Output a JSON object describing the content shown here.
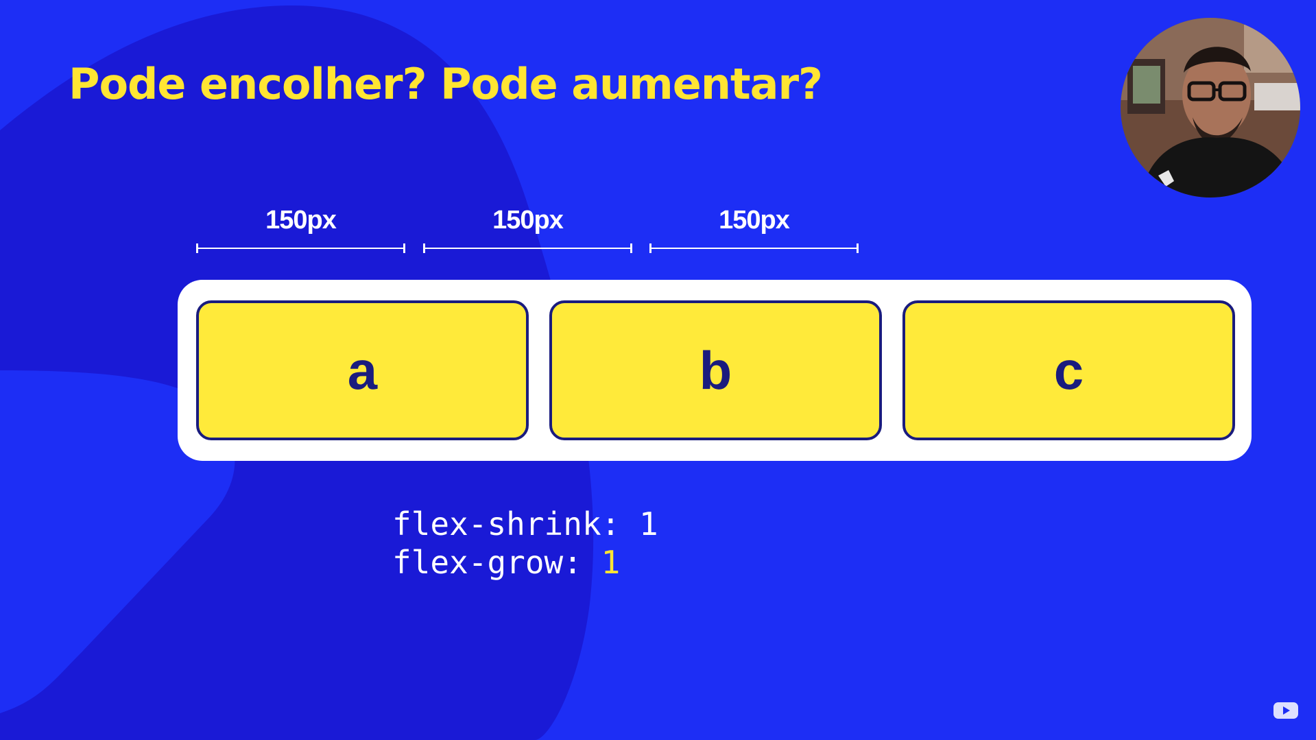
{
  "slide": {
    "title": "Pode encolher? Pode aumentar?"
  },
  "measurements": [
    {
      "label": "150px"
    },
    {
      "label": "150px"
    },
    {
      "label": "150px"
    }
  ],
  "flex_items": [
    {
      "label": "a"
    },
    {
      "label": "b"
    },
    {
      "label": "c"
    }
  ],
  "code": {
    "line1_property": "flex-shrink: ",
    "line1_value": "1",
    "line2_property": "flex-grow: ",
    "line2_value": "1"
  },
  "colors": {
    "background": "#1d2ef5",
    "blob": "#1a1ad6",
    "accent_yellow": "#ffe533",
    "item_fill": "#ffea3a",
    "item_border": "#1a1c7e",
    "container": "#ffffff"
  },
  "icons": {
    "webcam": "presenter-webcam",
    "watermark": "channel-logo-icon"
  }
}
